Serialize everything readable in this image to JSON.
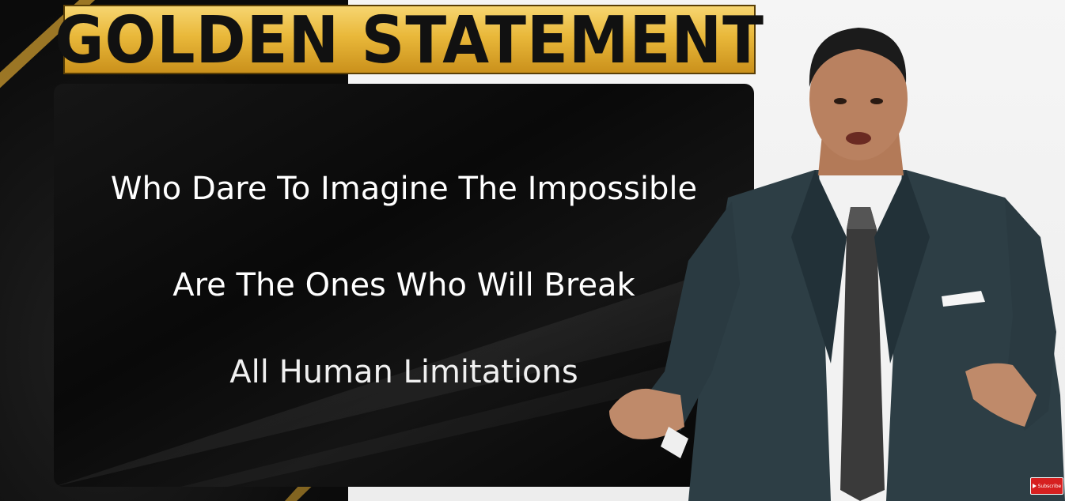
{
  "banner": {
    "title": "GOLDEN STATEMENT"
  },
  "quote": {
    "lines": [
      "Who Dare To Imagine The Impossible",
      "Are The Ones Who Will Break",
      "All Human Limitations"
    ]
  },
  "subscribe": {
    "label": "Subscribe",
    "icon": "play-icon"
  },
  "colors": {
    "gold": "#e9b83a",
    "background_dark": "#0a0a0a",
    "background_light": "#f0f0f0",
    "subscribe_red": "#d62020"
  }
}
